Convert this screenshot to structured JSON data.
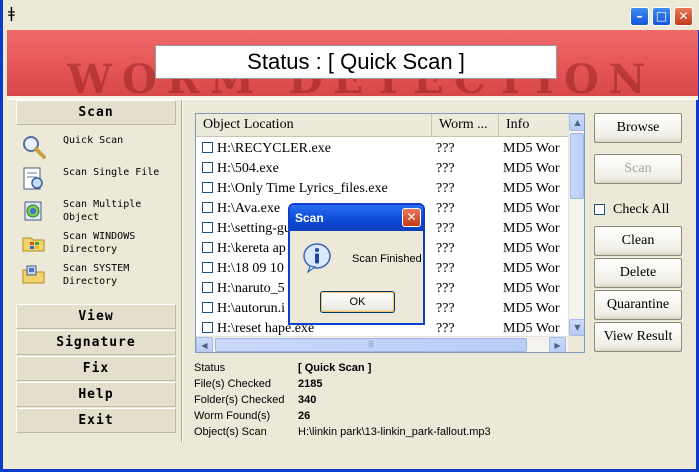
{
  "window": {
    "app_icon": "worm-app-icon",
    "minimize_glyph": "–",
    "maximize_glyph": "□",
    "close_glyph": "✕"
  },
  "banner": {
    "status_text": "Status : [ Quick Scan ]",
    "watermark": "WORM DETECTION"
  },
  "sidebar": {
    "scan_header": "Scan",
    "items": [
      {
        "label": "Quick Scan",
        "icon": "magnifier-icon"
      },
      {
        "label": "Scan Single File",
        "icon": "scan-file-icon"
      },
      {
        "label": "Scan Multiple Object",
        "icon": "scan-multiple-icon"
      },
      {
        "label": "Scan WINDOWS Directory",
        "icon": "windows-folder-icon"
      },
      {
        "label": "Scan SYSTEM Directory",
        "icon": "system-folder-icon"
      }
    ],
    "menu": [
      {
        "label": "View"
      },
      {
        "label": "Signature"
      },
      {
        "label": "Fix"
      },
      {
        "label": "Help"
      },
      {
        "label": "Exit"
      }
    ]
  },
  "list": {
    "columns": [
      "Object Location",
      "Worm ...",
      "Info"
    ],
    "rows": [
      [
        "H:\\RECYCLER.exe",
        "???",
        "MD5 Wor"
      ],
      [
        "H:\\504.exe",
        "???",
        "MD5 Wor"
      ],
      [
        "H:\\Only Time Lyrics_files.exe",
        "???",
        "MD5 Wor"
      ],
      [
        "H:\\Ava.exe",
        "???",
        "MD5 Wor"
      ],
      [
        "H:\\setting-gu",
        "???",
        "MD5 Wor"
      ],
      [
        "H:\\kereta ap",
        "???",
        "MD5 Wor"
      ],
      [
        "H:\\18 09 10",
        "???",
        "MD5 Wor"
      ],
      [
        "H:\\naruto_5",
        "???",
        "MD5 Wor"
      ],
      [
        "H:\\autorun.i",
        "???",
        "MD5 Wor"
      ],
      [
        "H:\\reset hape.exe",
        "???",
        "MD5 Wor"
      ]
    ],
    "hscroll_grip": "|||"
  },
  "buttons": {
    "browse": "Browse",
    "scan": "Scan",
    "check_all": "Check All",
    "clean": "Clean",
    "delete": "Delete",
    "quarantine": "Quarantine",
    "view_result": "View Result"
  },
  "info": {
    "status_label": "Status",
    "status_value": "[ Quick Scan ]",
    "files_label": "File(s) Checked",
    "files_value": "2185",
    "folders_label": "Folder(s) Checked",
    "folders_value": "340",
    "worms_label": "Worm Found(s)",
    "worms_value": "26",
    "object_label": "Object(s) Scan",
    "object_value": "H:\\linkin park\\13-linkin_park-fallout.mp3"
  },
  "dialog": {
    "title": "Scan",
    "message": "Scan Finished",
    "ok": "OK",
    "icon": "info-icon"
  },
  "colors": {
    "banner": "#e55454",
    "title_blue": "#0a49d4",
    "close_red": "#c33b18"
  }
}
